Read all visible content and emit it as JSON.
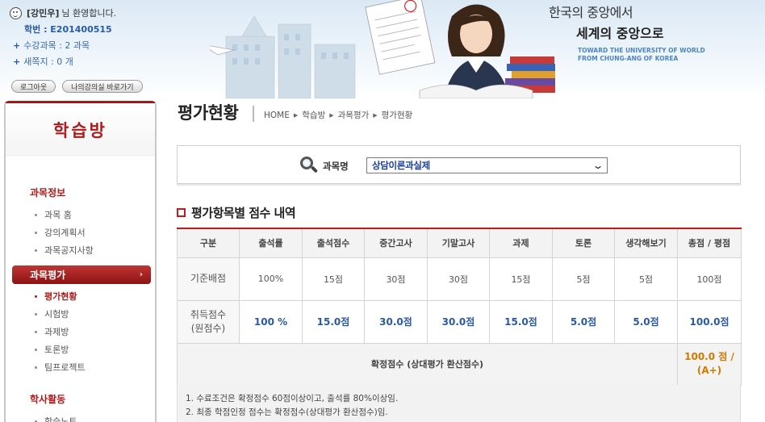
{
  "user": {
    "name": "[강민우]",
    "welcome": "님 환영합니다.",
    "student_id": "학번 : E201400515",
    "courses": "수강과목 : 2 과목",
    "messages": "새쪽지 : 0 개",
    "logout_label": "로그아웃",
    "shortcut_label": "나의강의실 바로가기"
  },
  "banner": {
    "slogan_line1": "한국의 중앙에서",
    "slogan_line2": "세계의 중앙으로",
    "slogan_en_line1": "TOWARD THE UNIVERSITY OF WORLD",
    "slogan_en_line2": "FROM CHUNG-ANG OF KOREA"
  },
  "sidebar": {
    "title": "학습방",
    "section1": "과목정보",
    "section1_items": [
      "과목 홈",
      "강의계획서",
      "과목공지사항"
    ],
    "active_section": "과목평가",
    "section2_items": [
      "평가현황",
      "시험방",
      "과제방",
      "토론방",
      "팀프로젝트"
    ],
    "section3": "학사활동",
    "section3_items": [
      "학습노트"
    ]
  },
  "page": {
    "title": "평가현황",
    "breadcrumb": [
      "HOME",
      "학습방",
      "과목평가",
      "평가현황"
    ]
  },
  "search": {
    "label": "과목명",
    "selected": "상담이론과실제"
  },
  "section_title": "평가항목별 점수 내역",
  "table": {
    "headers": [
      "구분",
      "출석률",
      "출석점수",
      "중간고사",
      "기말고사",
      "과제",
      "토론",
      "생각해보기",
      "총점 / 평점"
    ],
    "base_label": "기준배점",
    "base_values": [
      "100%",
      "15점",
      "30점",
      "30점",
      "15점",
      "5점",
      "5점",
      "100점"
    ],
    "got_label_1": "취득점수",
    "got_label_2": "(원점수)",
    "got_values": [
      "100 %",
      "15.0점",
      "30.0점",
      "30.0점",
      "15.0점",
      "5.0점",
      "5.0점",
      "100.0점"
    ],
    "final_label": "확정점수 (상대평가 환산점수)",
    "final_value_1": "100.0 점 /",
    "final_value_2": "(A+)"
  },
  "notes": [
    "1. 수료조건은 확정점수 60점이상이고, 출석률 80%이상임.",
    "2. 최종 학점인정 점수는 확정점수(상대평가 환산점수)임."
  ]
}
